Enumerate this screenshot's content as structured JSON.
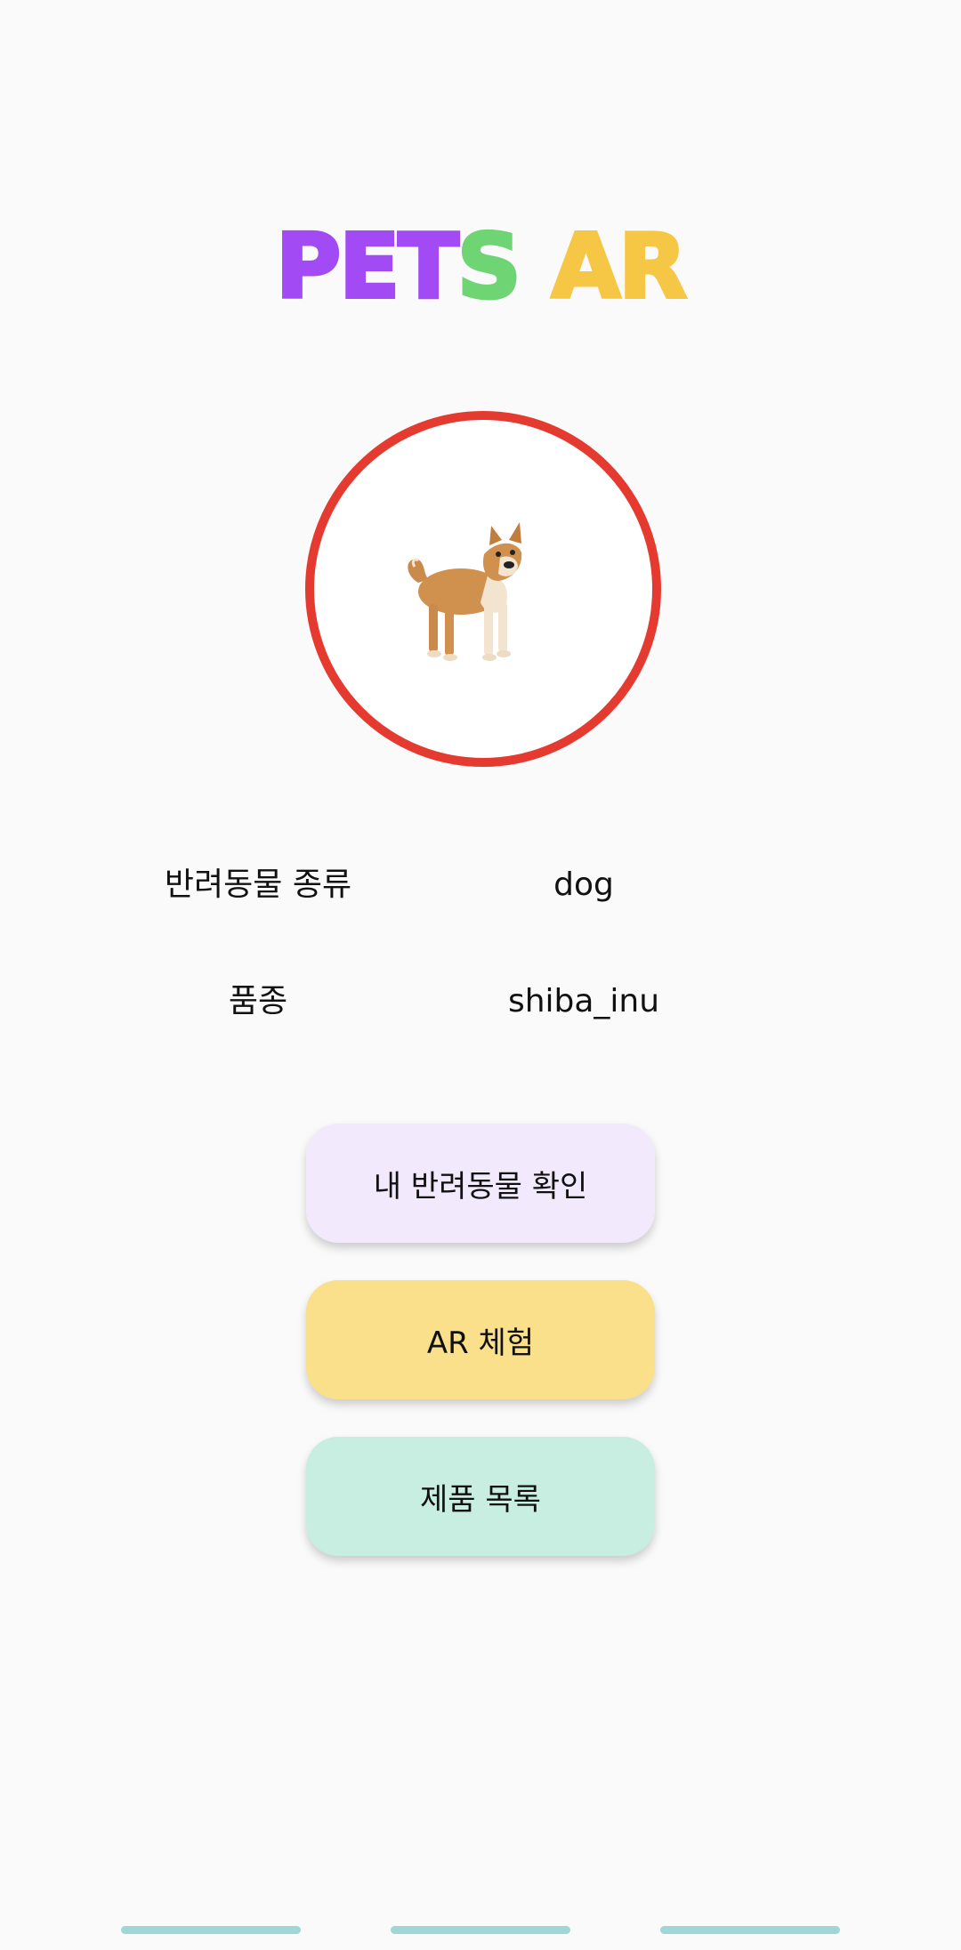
{
  "header": {
    "logo": [
      {
        "char": "P",
        "color": "#a24bf5"
      },
      {
        "char": "E",
        "color": "#a24bf5"
      },
      {
        "char": "T",
        "color": "#a24bf5"
      },
      {
        "char": "S",
        "color": "#6ed474"
      },
      {
        "char": " ",
        "color": "#fafafa"
      },
      {
        "char": "A",
        "color": "#f6c744"
      },
      {
        "char": "R",
        "color": "#f6c744"
      }
    ]
  },
  "pet_image": {
    "icon": "shiba-inu-dog-image",
    "ring_color": "#e53a30"
  },
  "info": {
    "species_label": "반려동물 종류",
    "species_value": "dog",
    "breed_label": "품종",
    "breed_value": "shiba_inu"
  },
  "buttons": {
    "my_pet": {
      "label": "내 반려동물 확인",
      "color": "#f2eafc"
    },
    "ar_experience": {
      "label": "AR 체험",
      "color": "#fae08b"
    },
    "product_list": {
      "label": "제품 목록",
      "color": "#c8eee2"
    }
  },
  "nav_bar": {
    "pill_color": "#9fd7d7"
  }
}
